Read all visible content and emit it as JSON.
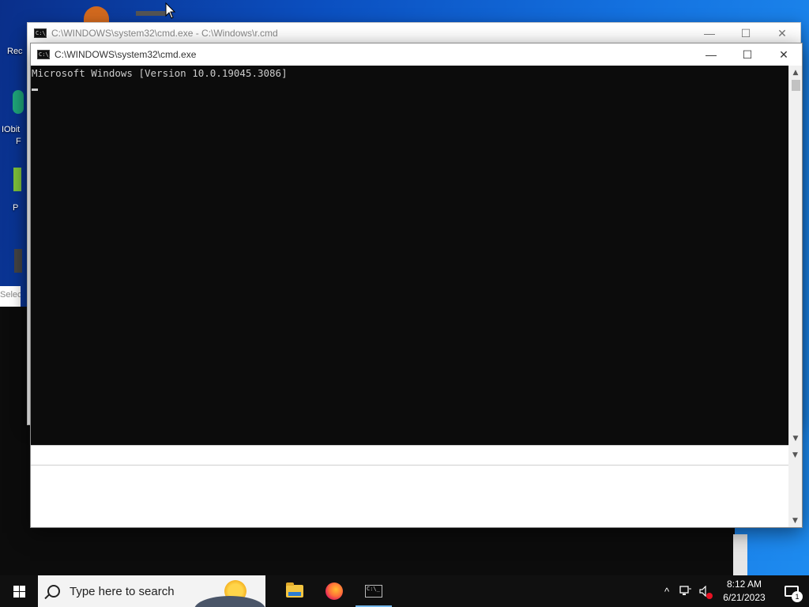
{
  "desktop": {
    "labels": [
      "Rec",
      "IObit",
      "F",
      "P",
      "Selec"
    ]
  },
  "back_window": {
    "title": "C:\\WINDOWS\\system32\\cmd.exe - C:\\Windows\\r.cmd",
    "minimize": "—",
    "maximize": "☐",
    "close": "✕"
  },
  "front_window": {
    "title": "C:\\WINDOWS\\system32\\cmd.exe",
    "minimize": "—",
    "maximize": "☐",
    "close": "✕",
    "console_text": "Microsoft Windows [Version 10.0.19045.3086]"
  },
  "taskbar": {
    "search_placeholder": "Type here to search",
    "apps": [
      {
        "name": "file-explorer-icon"
      },
      {
        "name": "firefox-icon"
      },
      {
        "name": "command-prompt-icon",
        "active": true
      }
    ],
    "tray": {
      "chevron": "^",
      "time": "8:12 AM",
      "date": "6/21/2023",
      "notification_count": "1"
    }
  },
  "colors": {
    "console_bg": "#0c0c0c",
    "console_fg": "#cccccc",
    "taskbar_bg": "#101010",
    "active_indicator": "#76b9ed"
  }
}
